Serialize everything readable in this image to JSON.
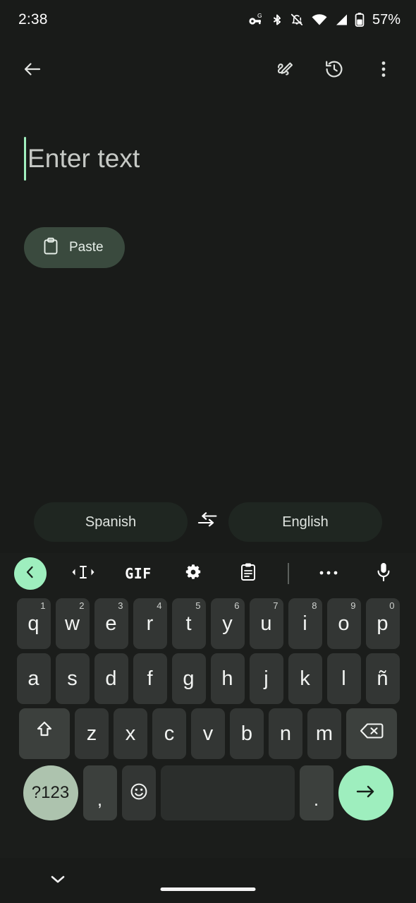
{
  "status_bar": {
    "time": "2:38",
    "battery_percent": "57%",
    "icons": [
      "vpn-key-icon",
      "bluetooth-icon",
      "notifications-muted-icon",
      "wifi-icon",
      "cellular-signal-icon",
      "battery-icon"
    ]
  },
  "app_bar": {
    "back_label": "back-arrow",
    "handwriting_label": "handwriting-input",
    "history_label": "history",
    "overflow_label": "more-options"
  },
  "text_entry": {
    "value": "",
    "placeholder": "Enter text",
    "caret_color": "#a0efbe"
  },
  "paste_chip": {
    "label": "Paste",
    "bg": "#3a4a3e"
  },
  "language_bar": {
    "source": "Spanish",
    "target": "English",
    "swap_label": "swap-languages"
  },
  "keyboard": {
    "toolbar": [
      {
        "name": "expand-toolbar",
        "glyph": "chevron-left",
        "accent": "#9eeebe"
      },
      {
        "name": "cursor-move",
        "glyph": "text-cursor"
      },
      {
        "name": "gif",
        "glyph": "GIF"
      },
      {
        "name": "settings",
        "glyph": "gear"
      },
      {
        "name": "clipboard",
        "glyph": "clipboard"
      },
      {
        "name": "more",
        "glyph": "dots"
      },
      {
        "name": "voice-input",
        "glyph": "microphone"
      }
    ],
    "gif_label": "GIF",
    "row1": [
      {
        "key": "q",
        "hint": "1"
      },
      {
        "key": "w",
        "hint": "2"
      },
      {
        "key": "e",
        "hint": "3"
      },
      {
        "key": "r",
        "hint": "4"
      },
      {
        "key": "t",
        "hint": "5"
      },
      {
        "key": "y",
        "hint": "6"
      },
      {
        "key": "u",
        "hint": "7"
      },
      {
        "key": "i",
        "hint": "8"
      },
      {
        "key": "o",
        "hint": "9"
      },
      {
        "key": "p",
        "hint": "0"
      }
    ],
    "row2": [
      "a",
      "s",
      "d",
      "f",
      "g",
      "h",
      "j",
      "k",
      "l",
      "ñ"
    ],
    "row3": [
      "z",
      "x",
      "c",
      "v",
      "b",
      "n",
      "m"
    ],
    "shift_label": "shift",
    "backspace_label": "backspace",
    "symbols_label": "?123",
    "comma_label": ",",
    "emoji_label": "emoji",
    "space_label": "space",
    "period_label": ".",
    "enter_label": "enter",
    "key_bg": "#333634",
    "fn_key_bg": "#3c403d",
    "enter_bg": "#9eeebe",
    "symbols_bg": "#adc3ae"
  },
  "nav_bar": {
    "hide_keyboard_label": "hide-keyboard",
    "home_indicator_label": "home-indicator"
  }
}
